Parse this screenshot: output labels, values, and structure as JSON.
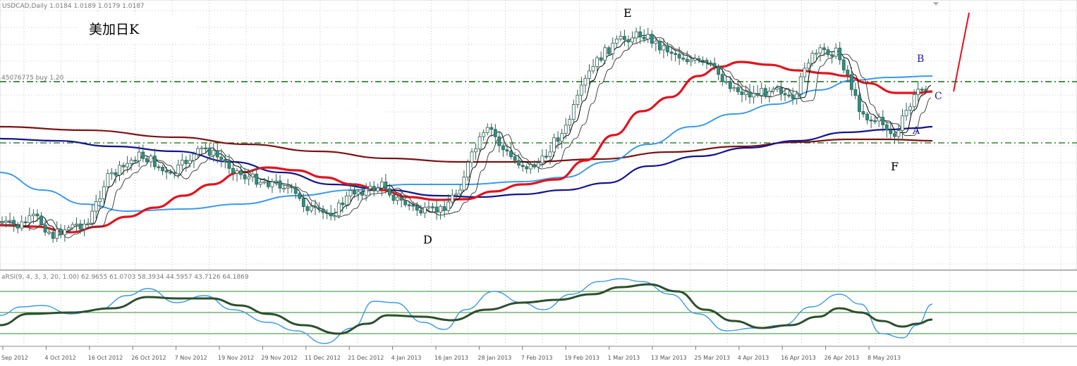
{
  "header": {
    "symbol_info": "USDCAD,Daily  1.0184 1.0189 1.0179 1.0187",
    "title": "美加日K",
    "level_label": "45076775 buy  1.20"
  },
  "indicator": {
    "label": "aRSI(9, 4, 3, 3, 20, 1.00) 62.9655 61.0703 58.3934 44.5957 43.7126 64.1869"
  },
  "point_labels": {
    "A": "A",
    "B": "B",
    "C": "C",
    "D": "D",
    "E": "E",
    "F": "F"
  },
  "colors": {
    "background": "#ffffff",
    "grid": "#c8c8c8",
    "bull_candle": "#ffffff",
    "bear_candle": "#2f8f7f",
    "ma_fast": "#000000",
    "ma_red": "#e0141e",
    "ma_light_blue": "#3c9be6",
    "ma_dark_blue": "#14148c",
    "ma_brown": "#7a1414",
    "level_line": "#0f6b0f",
    "rsi_main": "#2d4f2d",
    "rsi_fast": "#3c9be6",
    "rsi_levels": "#2e8b2e"
  },
  "chart_data": {
    "type": "candlestick",
    "symbol": "USDCAD",
    "timeframe": "Daily",
    "x_tick_labels": [
      "Sep 2012",
      "4 Oct 2012",
      "16 Oct 2012",
      "26 Oct 2012",
      "7 Nov 2012",
      "19 Nov 2012",
      "29 Nov 2012",
      "11 Dec 2012",
      "21 Dec 2012",
      "4 Jan 2013",
      "16 Jan 2013",
      "28 Jan 2013",
      "7 Feb 2013",
      "19 Feb 2013",
      "1 Mar 2013",
      "13 Mar 2013",
      "25 Mar 2013",
      "4 Apr 2013",
      "16 Apr 2013",
      "26 Apr 2013",
      "8 May 2013"
    ],
    "horizontal_levels": [
      "upper",
      "lower"
    ],
    "indicator_levels": [
      80,
      50,
      20
    ]
  }
}
